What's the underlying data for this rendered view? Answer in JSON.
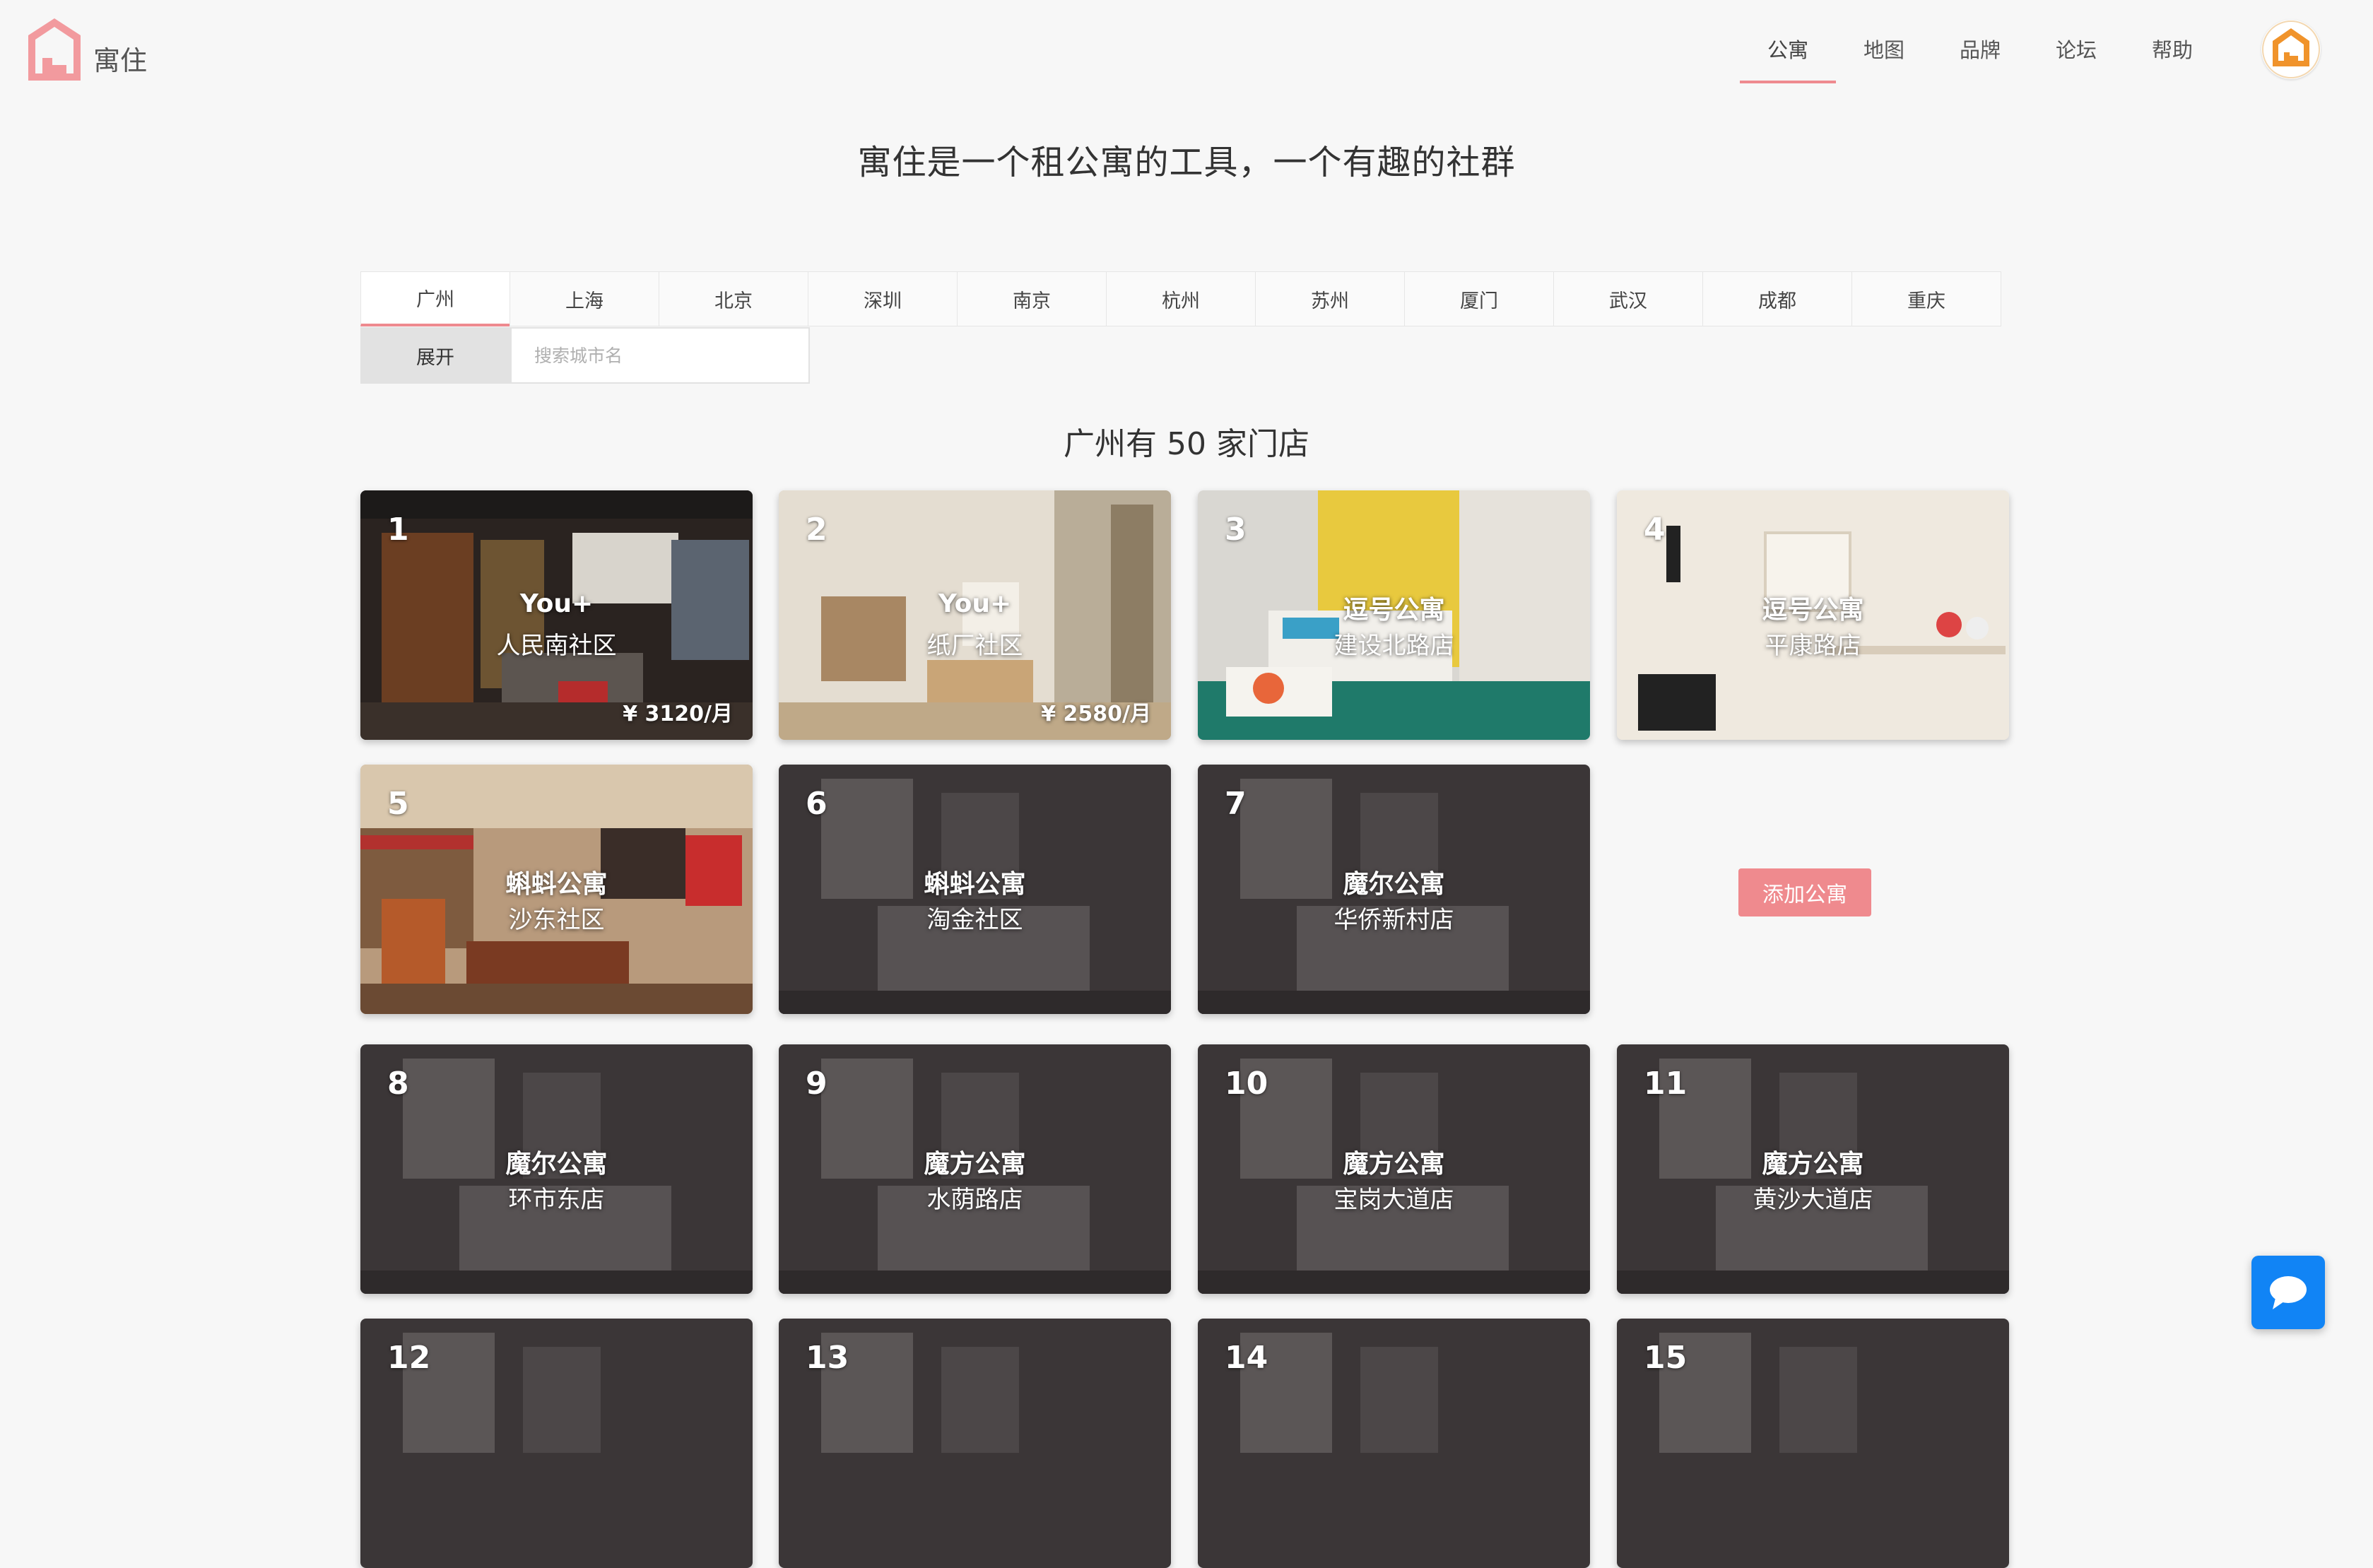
{
  "app": {
    "name": "寓住"
  },
  "nav": {
    "items": [
      {
        "label": "公寓",
        "active": true
      },
      {
        "label": "地图",
        "active": false
      },
      {
        "label": "品牌",
        "active": false
      },
      {
        "label": "论坛",
        "active": false
      },
      {
        "label": "帮助",
        "active": false
      }
    ]
  },
  "slogan": "寓住是一个租公寓的工具，一个有趣的社群",
  "cities": {
    "tabs": [
      "广州",
      "上海",
      "北京",
      "深圳",
      "南京",
      "杭州",
      "苏州",
      "厦门",
      "武汉",
      "成都",
      "重庆"
    ],
    "active": "广州",
    "expand_label": "展开",
    "search_placeholder": "搜索城市名"
  },
  "store_count_title": "广州有 50 家门店",
  "apartments": [
    {
      "num": "1",
      "brand": "You+",
      "branch": "人民南社区",
      "price": "¥ 3120/月",
      "scene": "loft"
    },
    {
      "num": "2",
      "brand": "You+",
      "branch": "纸厂社区",
      "price": "¥ 2580/月",
      "scene": "living"
    },
    {
      "num": "3",
      "brand": "逗号公寓",
      "branch": "建设北路店",
      "price": "",
      "scene": "bedroom"
    },
    {
      "num": "4",
      "brand": "逗号公寓",
      "branch": "平康路店",
      "price": "",
      "scene": "shelf"
    },
    {
      "num": "5",
      "brand": "蝌蚪公寓",
      "branch": "沙东社区",
      "price": "",
      "scene": "warm"
    },
    {
      "num": "6",
      "brand": "蝌蚪公寓",
      "branch": "淘金社区",
      "price": "",
      "scene": "dark"
    },
    {
      "num": "7",
      "brand": "魔尔公寓",
      "branch": "华侨新村店",
      "price": "",
      "scene": "dark"
    },
    {
      "num": "8",
      "brand": "魔尔公寓",
      "branch": "环市东店",
      "price": "",
      "scene": "dark"
    },
    {
      "num": "9",
      "brand": "魔方公寓",
      "branch": "水荫路店",
      "price": "",
      "scene": "dark"
    },
    {
      "num": "10",
      "brand": "魔方公寓",
      "branch": "宝岗大道店",
      "price": "",
      "scene": "dark"
    },
    {
      "num": "11",
      "brand": "魔方公寓",
      "branch": "黄沙大道店",
      "price": "",
      "scene": "dark"
    },
    {
      "num": "12",
      "brand": "",
      "branch": "",
      "price": "",
      "scene": "dark"
    },
    {
      "num": "13",
      "brand": "",
      "branch": "",
      "price": "",
      "scene": "dark"
    },
    {
      "num": "14",
      "brand": "",
      "branch": "",
      "price": "",
      "scene": "dark"
    },
    {
      "num": "15",
      "brand": "",
      "branch": "",
      "price": "",
      "scene": "dark"
    }
  ],
  "add_apartment_label": "添加公寓",
  "icons": {
    "logo": "house-logo-icon",
    "avatar": "user-avatar-icon",
    "chat": "chat-bubble-icon"
  },
  "colors": {
    "accent": "#ef8a8e",
    "chat": "#1184f5",
    "avatar_orange": "#f0932b",
    "background": "#f7f7f7"
  }
}
